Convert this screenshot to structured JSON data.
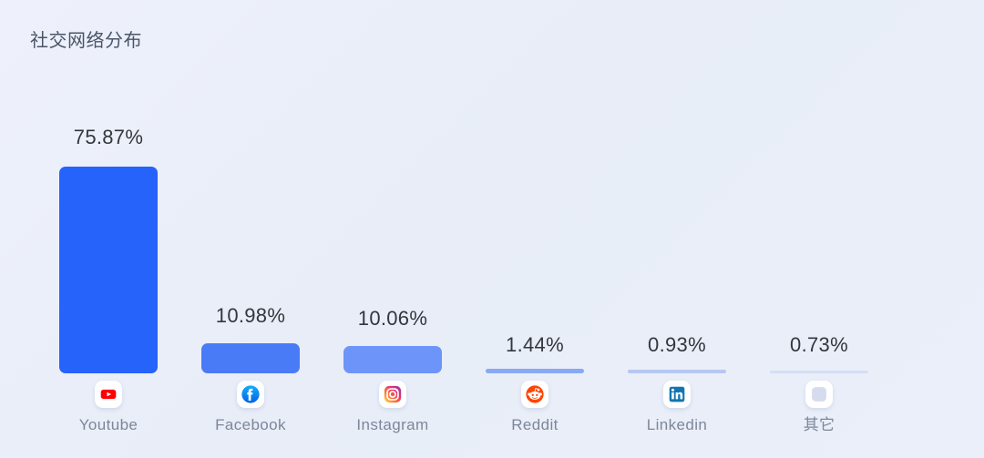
{
  "chart_data": {
    "type": "bar",
    "title": "社交网络分布",
    "xlabel": "",
    "ylabel": "",
    "ylim": [
      0,
      75.87
    ],
    "grid": false,
    "legend": false,
    "unit": "%",
    "categories": [
      "Youtube",
      "Facebook",
      "Instagram",
      "Reddit",
      "Linkedin",
      "其它"
    ],
    "values": [
      75.87,
      10.98,
      10.06,
      1.44,
      0.93,
      0.73
    ],
    "value_labels": [
      "75.87%",
      "10.98%",
      "10.06%",
      "1.44%",
      "0.93%",
      "0.73%"
    ],
    "bar_colors": [
      "#2563fb",
      "#4a7bf7",
      "#6d94f8",
      "#89a9f4",
      "#b6c8f2",
      "#d4def4"
    ],
    "icons": [
      "youtube-icon",
      "facebook-icon",
      "instagram-icon",
      "reddit-icon",
      "linkedin-icon",
      "other-icon"
    ]
  },
  "colors": {
    "background": "#e9eefa",
    "title_text": "#4a5568",
    "value_text": "#33363d",
    "category_text": "#7d8799",
    "accent": "#2563fb"
  }
}
